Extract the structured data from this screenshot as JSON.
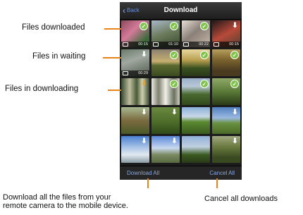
{
  "navbar": {
    "back_label": "Back",
    "title": "Download"
  },
  "thumbnails": [
    {
      "status": "downloaded",
      "video": true,
      "duration": "00:15"
    },
    {
      "status": "downloaded",
      "video": true,
      "duration": "01:10"
    },
    {
      "status": "downloaded",
      "video": true,
      "duration": "00:22"
    },
    {
      "status": "waiting",
      "video": true,
      "duration": "00:15"
    },
    {
      "status": "waiting",
      "video": true,
      "duration": "00:29"
    },
    {
      "status": "downloaded",
      "video": false,
      "duration": ""
    },
    {
      "status": "downloaded",
      "video": false,
      "duration": ""
    },
    {
      "status": "downloaded",
      "video": false,
      "duration": ""
    },
    {
      "status": "downloading",
      "video": false,
      "duration": ""
    },
    {
      "status": "downloaded",
      "video": false,
      "duration": ""
    },
    {
      "status": "downloaded",
      "video": false,
      "duration": ""
    },
    {
      "status": "downloaded",
      "video": false,
      "duration": ""
    },
    {
      "status": "waiting",
      "video": false,
      "duration": ""
    },
    {
      "status": "waiting",
      "video": false,
      "duration": ""
    },
    {
      "status": "none",
      "video": false,
      "duration": ""
    },
    {
      "status": "waiting",
      "video": false,
      "duration": ""
    },
    {
      "status": "waiting",
      "video": false,
      "duration": ""
    },
    {
      "status": "waiting",
      "video": false,
      "duration": ""
    },
    {
      "status": "none",
      "video": false,
      "duration": ""
    },
    {
      "status": "waiting",
      "video": false,
      "duration": ""
    }
  ],
  "bottombar": {
    "download_all": "Download All",
    "cancel_all": "Cancel All"
  },
  "callouts": {
    "downloaded": "Files downloaded",
    "waiting": "Files in waiting",
    "downloading": "Files in downloading"
  },
  "captions": {
    "download_all_line1": "Download all the files from your",
    "download_all_line2": "remote camera to the mobile device.",
    "cancel_all": "Cancel all downloads"
  },
  "colors": {
    "accent_orange": "#e8841c",
    "done_green": "#7ec44a",
    "link_blue": "#8aa8e0"
  }
}
